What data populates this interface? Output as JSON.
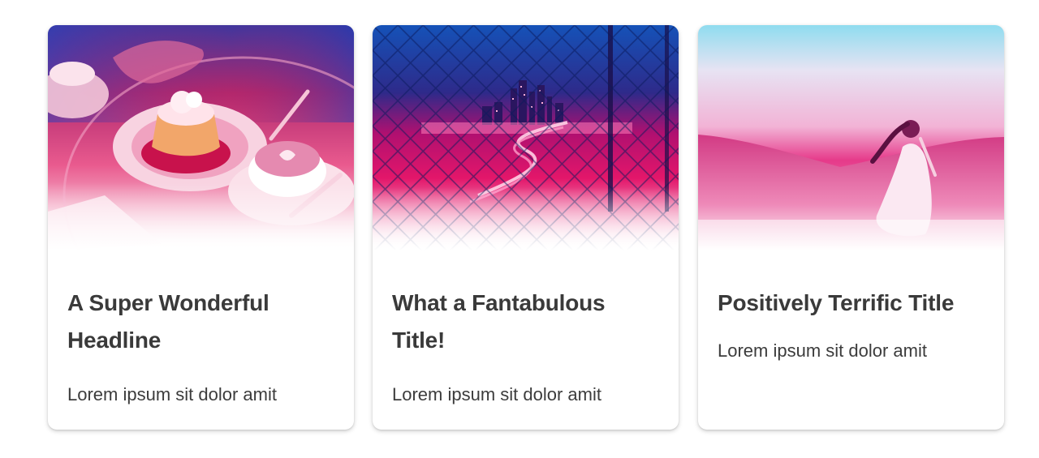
{
  "cards": [
    {
      "title": "A Super Wonderful Headline",
      "text": "Lorem ipsum sit dolor amit",
      "image_icon": "dessert-coffee-photo"
    },
    {
      "title": "What a Fantabulous Title!",
      "text": "Lorem ipsum sit dolor amit",
      "image_icon": "city-night-fence-photo"
    },
    {
      "title": "Positively Terrific Title",
      "text": "Lorem ipsum sit dolor amit",
      "image_icon": "woman-hill-photo"
    }
  ],
  "colors": {
    "gradient_top_blue": "#1a3fb8",
    "gradient_mid_magenta": "#e8116f",
    "gradient_bottom": "#ffffff",
    "sky_cyan": "#8fdcef",
    "title": "#3a3a3a",
    "text": "#3c3c3c"
  }
}
